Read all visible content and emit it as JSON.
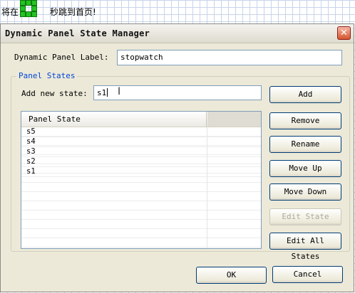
{
  "canvas": {
    "text_left": "将在",
    "text_right": "秒跳到首页!"
  },
  "dialog": {
    "title": "Dynamic Panel State Manager"
  },
  "label_row": {
    "label": "Dynamic Panel Label:",
    "value": "stopwatch"
  },
  "group": {
    "title": "Panel States"
  },
  "add_state": {
    "label": "Add new state:",
    "value": "s1"
  },
  "list": {
    "columns": [
      "Panel State",
      ""
    ],
    "rows": [
      "s5",
      "s4",
      "s3",
      "s2",
      "s1"
    ]
  },
  "buttons": {
    "add": "Add",
    "remove": "Remove",
    "rename": "Rename",
    "move_up": "Move Up",
    "move_down": "Move Down",
    "edit_state": "Edit State",
    "edit_all": "Edit All States",
    "ok": "OK",
    "cancel": "Cancel"
  },
  "icons": {
    "close": "close-icon",
    "text_cursor": "text-cursor-icon"
  }
}
